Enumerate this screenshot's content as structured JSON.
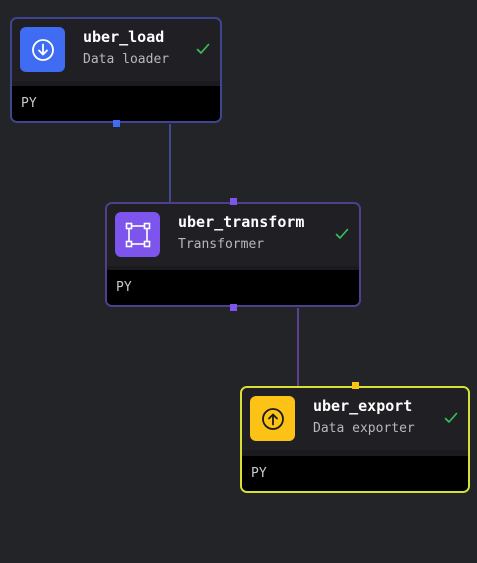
{
  "nodes": {
    "load": {
      "name": "uber_load",
      "type": "Data loader",
      "language": "PY",
      "icon": "download-circle-icon",
      "color": "#3f6cf3",
      "status": "success"
    },
    "transform": {
      "name": "uber_transform",
      "type": "Transformer",
      "language": "PY",
      "icon": "transform-square-icon",
      "color": "#7d55ec",
      "status": "success"
    },
    "export": {
      "name": "uber_export",
      "type": "Data exporter",
      "language": "PY",
      "icon": "upload-circle-icon",
      "color": "#fcc215",
      "status": "success",
      "selected": true
    }
  },
  "edges": [
    {
      "from": "uber_load",
      "to": "uber_transform"
    },
    {
      "from": "uber_transform",
      "to": "uber_export"
    }
  ],
  "colors": {
    "background": "#232428",
    "edge_load": "#3f4590",
    "edge_transform": "#4f3f8f",
    "success_check": "#38c05c",
    "selected_border": "#d8e033"
  }
}
